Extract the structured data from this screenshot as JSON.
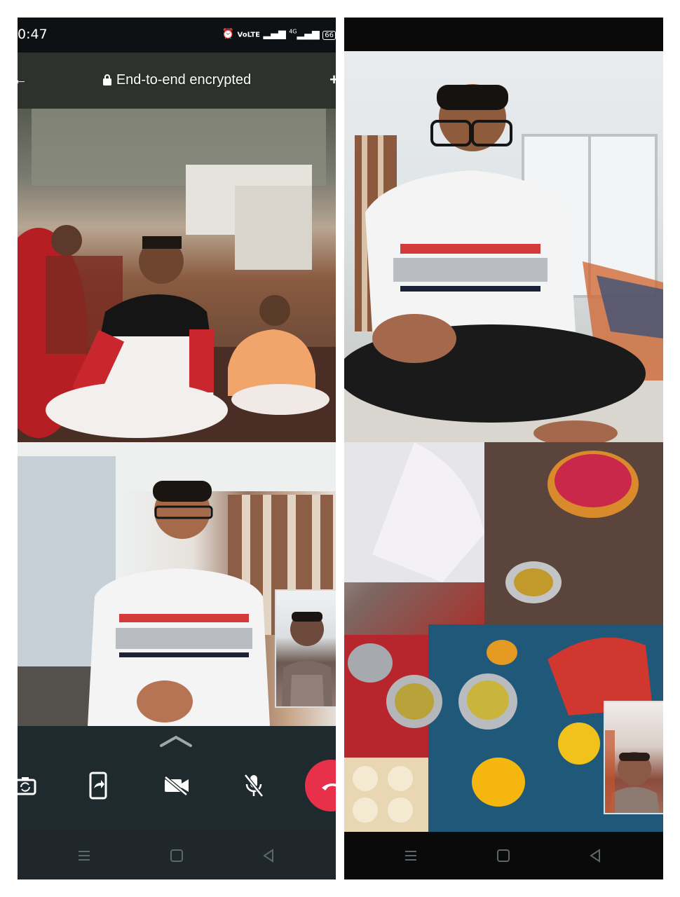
{
  "status_bar": {
    "time": "0:47",
    "icons": [
      "alarm-icon",
      "volte-icon",
      "signal-icon",
      "4g-signal-icon",
      "battery-icon"
    ],
    "battery_text": "66"
  },
  "call": {
    "encryption_label": "End-to-end encrypted"
  },
  "controls": {
    "items": [
      "switch-camera-icon",
      "screen-share-icon",
      "video-off-icon",
      "mute-icon",
      "end-call-icon"
    ],
    "end_call_color": "#e8304a"
  },
  "nav": {
    "items": [
      "recents-icon",
      "home-icon",
      "back-icon"
    ]
  }
}
